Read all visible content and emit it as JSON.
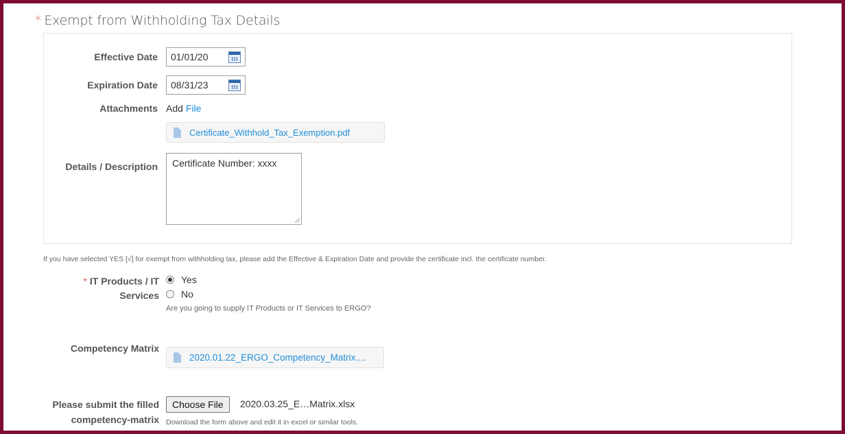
{
  "section": {
    "title": "Exempt from Withholding Tax Details",
    "required_marker": "*"
  },
  "effective_date": {
    "label": "Effective Date",
    "value": "01/01/20"
  },
  "expiration_date": {
    "label": "Expiration Date",
    "value": "08/31/23"
  },
  "attachments": {
    "label": "Attachments",
    "add_text": "Add",
    "file_link": "File",
    "file_name": "Certificate_Withhold_Tax_Exemption.pdf"
  },
  "details": {
    "label": "Details / Description",
    "value": "Certificate Number: xxxx"
  },
  "exempt_hint": "If you have selected YES [√] for exempt from withholding tax, please add the Effective & Expiration Date and provide the certificate incl. the certificate number.",
  "it_products": {
    "required_marker": "*",
    "label_line1": "IT Products / IT",
    "label_line2": "Services",
    "options": [
      {
        "label": "Yes",
        "checked": true
      },
      {
        "label": "No",
        "checked": false
      }
    ],
    "hint": "Are you going to supply IT Products or IT Services to ERGO?"
  },
  "competency_matrix": {
    "label": "Competency Matrix",
    "file_name": "2020.01.22_ERGO_Competency_Matrix...."
  },
  "submit_matrix": {
    "label_line1": "Please submit the filled",
    "label_line2": "competency-matrix",
    "button_label": "Choose File",
    "chosen_file": "2020.03.25_E…Matrix.xlsx",
    "hint": "Download the form above and edit it in excel or similar tools."
  },
  "colors": {
    "frame": "#7d0b33",
    "link": "#1f8dd6",
    "required": "#d9534f"
  },
  "icons": {
    "calendar": "calendar-icon",
    "document": "document-icon"
  }
}
